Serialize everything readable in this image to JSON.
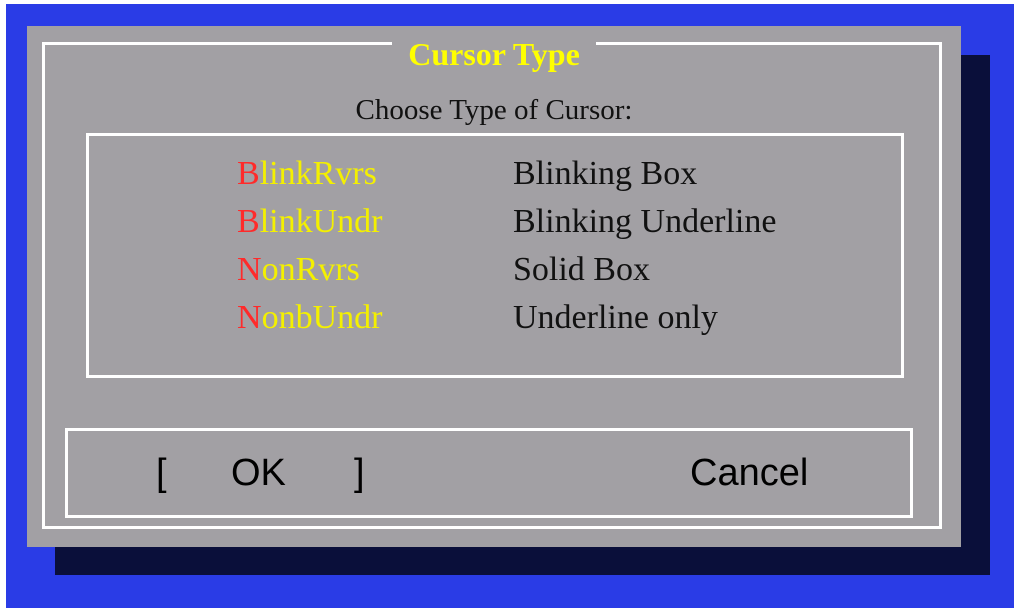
{
  "dialog": {
    "title": "Cursor Type",
    "prompt": "Choose Type of Cursor:",
    "options": [
      {
        "hotkey": "B",
        "rest": "linkRvrs",
        "description": "Blinking Box"
      },
      {
        "hotkey": "B",
        "rest": "linkUndr",
        "description": "Blinking Underline"
      },
      {
        "hotkey": "N",
        "rest": "onRvrs",
        "description": "Solid Box"
      },
      {
        "hotkey": "N",
        "rest": "onbUndr",
        "description": "Underline only"
      }
    ],
    "buttons": {
      "ok_left_bracket": "[",
      "ok_label": "OK",
      "ok_right_bracket": "]",
      "cancel_label": "Cancel"
    }
  },
  "colors": {
    "screen_background": "#2a3ce6",
    "dialog_background": "#a2a0a4",
    "title_color": "#ffff00",
    "hotkey_color": "#ff2a2a",
    "option_color": "#f4f000"
  }
}
